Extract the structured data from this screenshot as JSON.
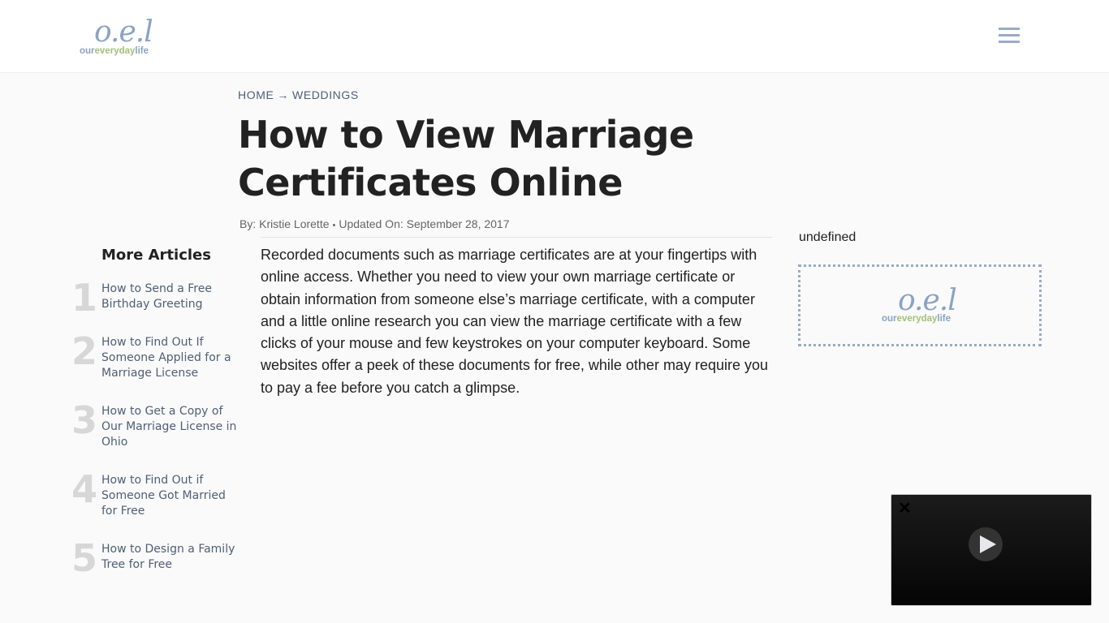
{
  "header": {
    "logo": {
      "mark": "o.e.l",
      "word_parts": [
        "our",
        "everyday",
        "life"
      ]
    },
    "menu_icon": "hamburger-menu-icon"
  },
  "breadcrumb": {
    "items": [
      "HOME",
      "WEDDINGS"
    ],
    "separator": "→"
  },
  "article": {
    "title": "How to View Marriage Certificates Online",
    "byline": {
      "author": "By: Kristie Lorette",
      "separator": "•",
      "updated": "Updated On: September 28, 2017"
    },
    "body": "Recorded documents such as marriage certificates are at your fingertips with online access. Whether you need to view your own marriage certificate or obtain information from someone else’s marriage certificate, with a computer and a little online research you can view the marriage certificate with a few clicks of your mouse and few keystrokes on your computer keyboard. Some websites offer a peek of these documents for free, while other may require you to pay a fee before you catch a glimpse."
  },
  "more_articles": {
    "heading": "More Articles",
    "items": [
      {
        "num": "1",
        "title": "How to Send a Free Birthday Greeting"
      },
      {
        "num": "2",
        "title": "How to Find Out If Someone Applied for a Marriage License"
      },
      {
        "num": "3",
        "title": "How to Get a Copy of Our Marriage License in Ohio"
      },
      {
        "num": "4",
        "title": "How to Find Out if Someone Got Married for Free"
      },
      {
        "num": "5",
        "title": "How to Design a Family Tree for Free"
      }
    ]
  },
  "sidebar": {
    "label": "undefined",
    "ad_logo": {
      "mark": "o.e.l",
      "word_parts": [
        "our",
        "everyday",
        "life"
      ]
    }
  },
  "video": {
    "close_icon": "close-icon",
    "close_glyph": "✕",
    "play_icon": "play-icon"
  },
  "colors": {
    "brand_blue": "#8aa3c2",
    "brand_green": "#a3bf7a",
    "link": "#4f5f76",
    "number_gray": "#d7d7d7"
  }
}
